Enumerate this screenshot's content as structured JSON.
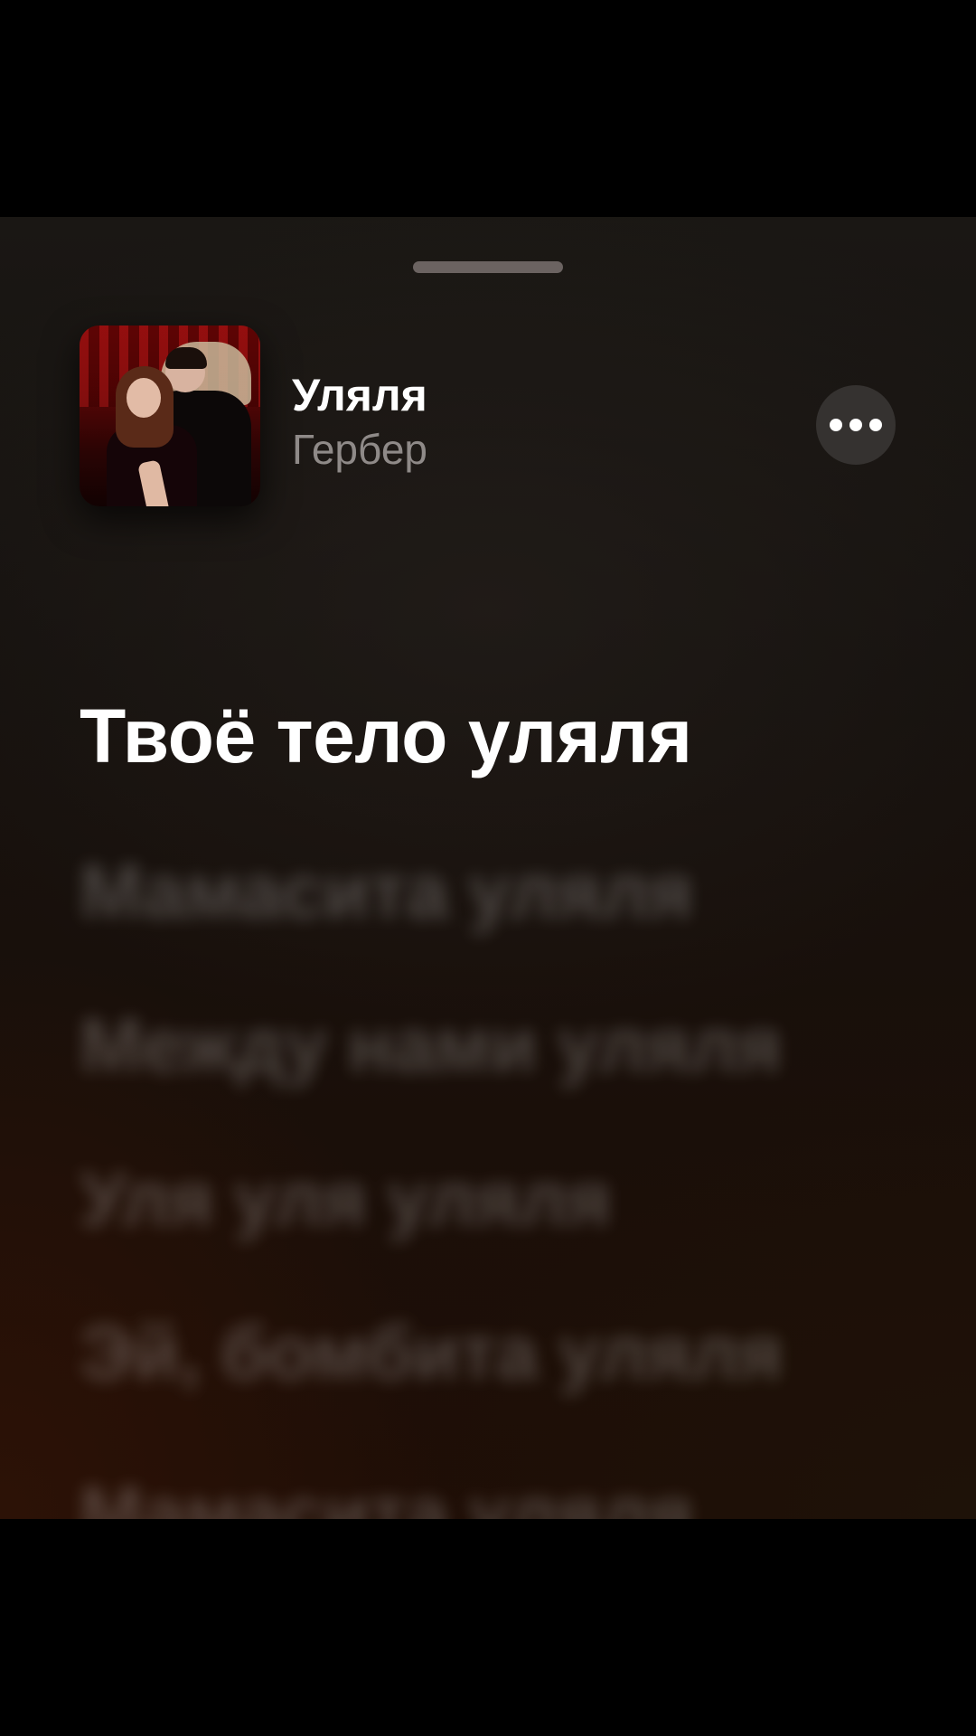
{
  "now_playing": {
    "track_title": "Уляля",
    "artist": "Гербер",
    "artwork_icon": "album-artwork"
  },
  "lyrics": {
    "active_line": "Твоё тело уляля",
    "upcoming_lines": [
      "Мамасита уляля",
      "Между нами уляля",
      "Уля уля уляля",
      "Эй, бомбита уляля",
      "Мамасита уляля"
    ]
  },
  "icons": {
    "more": "ellipsis-icon",
    "grabber": "sheet-grabber"
  },
  "colors": {
    "background": "#000000",
    "active_lyric": "#ffffff",
    "artist_text": "#8f8a88",
    "more_button_bg": "#353230"
  }
}
